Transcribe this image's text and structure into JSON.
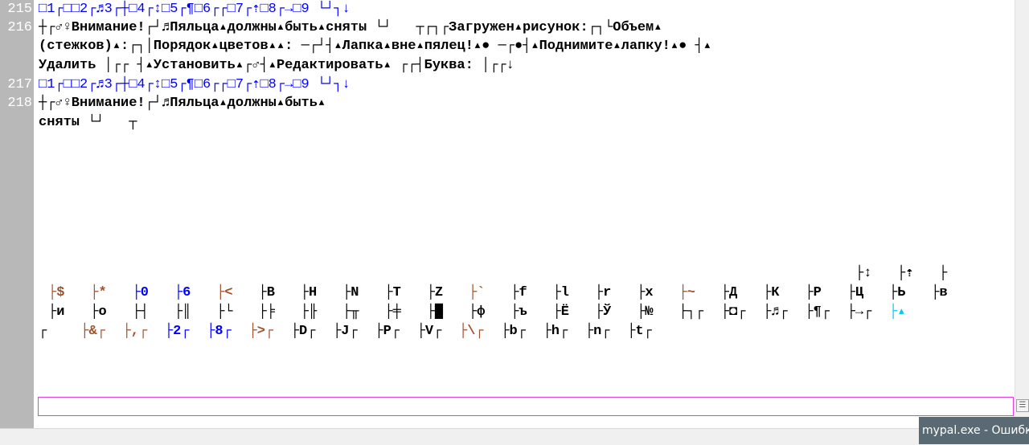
{
  "line_numbers": [
    "215",
    "216",
    "217",
    "218"
  ],
  "lines": {
    "l215": "□1┌□□2┌♬3┌┼□4┌↕□5┌¶□6┌┌□7┌⇡□8┌→□9 └┘┐↓",
    "l216a": "┼┌♂♀Внимание!┌┘♬Пяльца▴должны▴быть▴сняты └┘   ┬┌┐┌Загружен▴рисунок:┌┐└Объем▴",
    "l216b": "(стежков)▴:┌┐│Порядок▴цветов▴▴: ─┌┘┤▴Лапка▴вне▴пялец!▴● ─┌●┤▴Поднимите▴лапку!▴● ┤▴",
    "l216c": "Удалить │┌┌ ┤▴Установить▴┌♂┤▴Редактировать▴ ┌┌┤Буква: │┌┌↓",
    "l217": "□1┌□□2┌♬3┌┼□4┌↕□5┌¶□6┌┌□7┌⇡□8┌→□9 └┘┐↓",
    "l218a": "┼┌♂♀Внимание!┌┘♬Пяльца▴должны▴быть▴",
    "l218b": "сняты └┘   ┬"
  },
  "grid": {
    "row0": [
      "├↕",
      "├⇡",
      "├"
    ],
    "row1": [
      "├$",
      "├*",
      "├0",
      "├6",
      "├<",
      "├B",
      "├H",
      "├N",
      "├T",
      "├Z",
      "├`",
      "├f",
      "├l",
      "├r",
      "├x",
      "├~",
      "├Д",
      "├К",
      "├Р",
      "├Ц",
      "├Ь",
      "├в"
    ],
    "row2": [
      "├и",
      "├о",
      "├┤",
      "├║",
      "├└",
      "├╞",
      "├╟",
      "├╥",
      "├╪",
      "├█",
      "├ф",
      "├ъ",
      "├Ё",
      "├Ў",
      "├№",
      "├┐┌",
      "├◘┌",
      "├♬┌",
      "├¶┌",
      "├→┌",
      "├▴"
    ],
    "row3": [
      "┌",
      "├&┌",
      "├,┌",
      "├2┌",
      "├8┌",
      "├>┌",
      "├D┌",
      "├J┌",
      "├P┌",
      "├V┌",
      "├\\┌",
      "├b┌",
      "├h┌",
      "├n┌",
      "├t┌"
    ]
  },
  "input": {
    "value": ""
  },
  "taskbar": {
    "popup_text": "mypal.exe - Ошибка"
  },
  "colors": {
    "gutter": "#b8b8b8",
    "digits": "#0000ff",
    "markers": "#00c8ff",
    "border": "#e040e0"
  }
}
